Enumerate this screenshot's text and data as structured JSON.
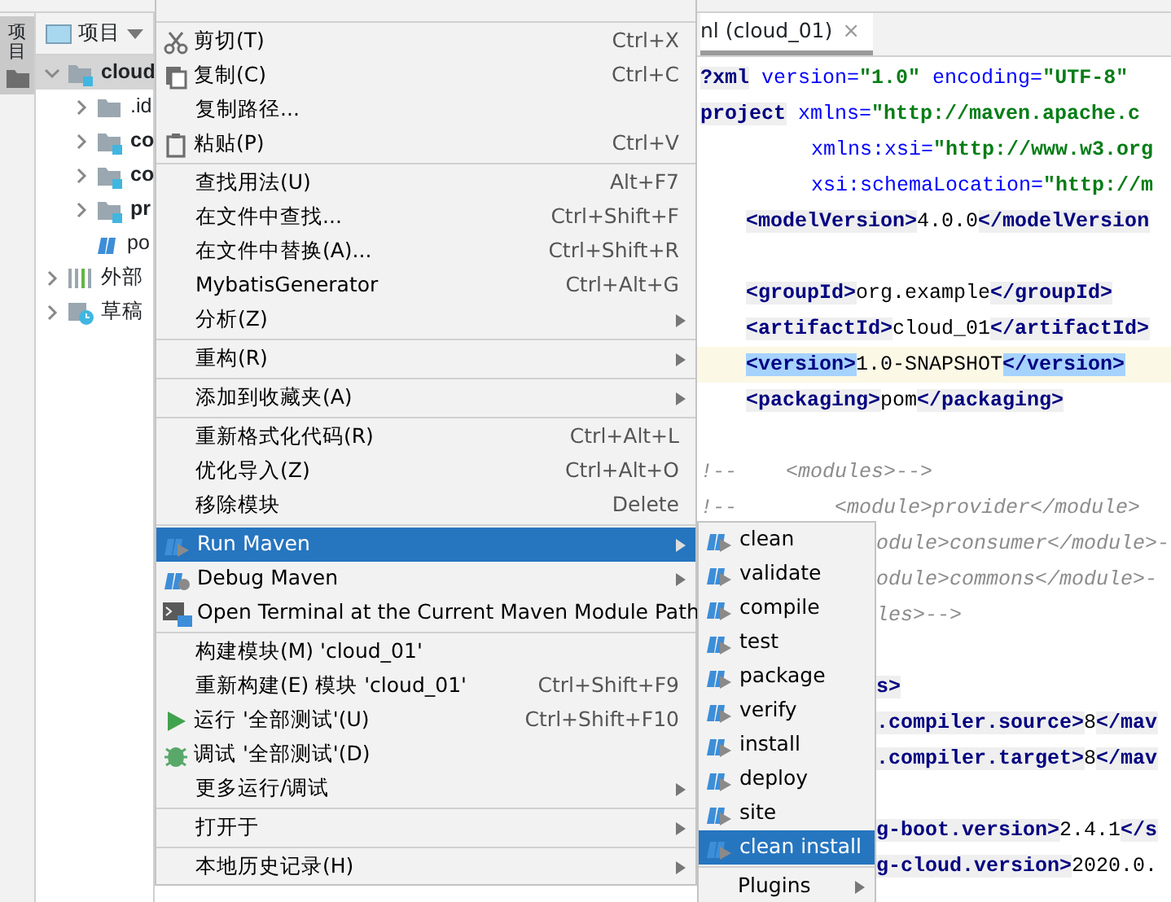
{
  "tool_window_tab": {
    "label": "项目",
    "selected": true
  },
  "project_panel": {
    "title": "项目",
    "tree": [
      {
        "label": "cloud",
        "kind": "module",
        "expanded": true,
        "selected": true,
        "children": [
          {
            "label": ".id",
            "kind": "folder",
            "expanded": false,
            "selected": false
          },
          {
            "label": "co",
            "kind": "module",
            "expanded": false,
            "selected": false
          },
          {
            "label": "co",
            "kind": "module",
            "expanded": false,
            "selected": false
          },
          {
            "label": "pr",
            "kind": "module",
            "expanded": false,
            "selected": false
          },
          {
            "label": "po",
            "kind": "maven",
            "selected": false
          }
        ]
      },
      {
        "label": "外部",
        "kind": "library",
        "expanded": false,
        "selected": false
      },
      {
        "label": "草稿",
        "kind": "scratch",
        "expanded": false,
        "selected": false
      }
    ]
  },
  "editor": {
    "tab": {
      "label": "nl (cloud_01)",
      "close": "×",
      "selected": true
    },
    "lines": [
      {
        "kind": "code",
        "current": false,
        "segments": [
          {
            "kind": "tag",
            "text": "?xml"
          },
          {
            "kind": "attr",
            "text": " version="
          },
          {
            "kind": "str",
            "text": "\"1.0\""
          },
          {
            "kind": "attr",
            "text": " encoding="
          },
          {
            "kind": "str",
            "text": "\"UTF-8\""
          }
        ]
      },
      {
        "kind": "code",
        "current": false,
        "segments": [
          {
            "kind": "tag",
            "text": "project"
          },
          {
            "kind": "attr",
            "text": " xmlns="
          },
          {
            "kind": "str",
            "text": "\"http://maven.apache.c"
          }
        ]
      },
      {
        "kind": "attr-indented",
        "current": false,
        "segments": [
          {
            "kind": "attr",
            "text": "xmlns:xsi="
          },
          {
            "kind": "str",
            "text": "\"http://www.w3.org"
          }
        ]
      },
      {
        "kind": "attr-indented",
        "current": false,
        "segments": [
          {
            "kind": "attr",
            "text": "xsi:schemaLocation="
          },
          {
            "kind": "str",
            "text": "\"http://m"
          }
        ]
      },
      {
        "kind": "indented",
        "current": false,
        "segments": [
          {
            "kind": "tag",
            "text": "<modelVersion>"
          },
          {
            "kind": "text",
            "text": "4.0.0"
          },
          {
            "kind": "tag",
            "text": "</modelVersion"
          }
        ]
      },
      {
        "kind": "blank"
      },
      {
        "kind": "indented",
        "current": false,
        "segments": [
          {
            "kind": "tag",
            "text": "<groupId>"
          },
          {
            "kind": "text",
            "text": "org.example"
          },
          {
            "kind": "tag",
            "text": "</groupId>"
          }
        ]
      },
      {
        "kind": "indented",
        "current": false,
        "segments": [
          {
            "kind": "tag",
            "text": "<artifactId>"
          },
          {
            "kind": "text",
            "text": "cloud_01"
          },
          {
            "kind": "tag",
            "text": "</artifactId>"
          }
        ]
      },
      {
        "kind": "indented",
        "current": true,
        "segments": [
          {
            "kind": "match",
            "text": "<version>"
          },
          {
            "kind": "text",
            "text": "1.0-SNAPSHOT"
          },
          {
            "kind": "match",
            "text": "</version>"
          }
        ]
      },
      {
        "kind": "indented",
        "current": false,
        "segments": [
          {
            "kind": "tag",
            "text": "<packaging>"
          },
          {
            "kind": "text",
            "text": "pom"
          },
          {
            "kind": "tag",
            "text": "</packaging>"
          }
        ]
      },
      {
        "kind": "blank"
      },
      {
        "kind": "code",
        "current": false,
        "segments": [
          {
            "kind": "comment",
            "text": "!--    <modules>-->"
          }
        ]
      },
      {
        "kind": "code",
        "current": false,
        "segments": [
          {
            "kind": "comment",
            "text": "!--        <module>provider</module>"
          }
        ]
      },
      {
        "kind": "clipped",
        "current": false,
        "segments": [
          {
            "kind": "comment",
            "text": "odule>consumer</module>-"
          }
        ]
      },
      {
        "kind": "clipped",
        "current": false,
        "segments": [
          {
            "kind": "comment",
            "text": "odule>commons</module>-"
          }
        ]
      },
      {
        "kind": "clipped",
        "current": false,
        "segments": [
          {
            "kind": "comment",
            "text": "les>-->"
          }
        ]
      },
      {
        "kind": "blank"
      },
      {
        "kind": "clipped",
        "current": false,
        "segments": [
          {
            "kind": "tag",
            "text": "s>"
          }
        ]
      },
      {
        "kind": "clipped",
        "current": false,
        "segments": [
          {
            "kind": "tag",
            "text": ".compiler.source>"
          },
          {
            "kind": "text",
            "text": "8"
          },
          {
            "kind": "tag",
            "text": "</mav"
          }
        ]
      },
      {
        "kind": "clipped",
        "current": false,
        "segments": [
          {
            "kind": "tag",
            "text": ".compiler.target>"
          },
          {
            "kind": "text",
            "text": "8"
          },
          {
            "kind": "tag",
            "text": "</mav"
          }
        ]
      },
      {
        "kind": "blank"
      },
      {
        "kind": "clipped",
        "current": false,
        "segments": [
          {
            "kind": "tag",
            "text": "g-boot.version>"
          },
          {
            "kind": "text",
            "text": "2.4.1"
          },
          {
            "kind": "tag",
            "text": "</s"
          }
        ]
      },
      {
        "kind": "clipped",
        "current": false,
        "segments": [
          {
            "kind": "tag",
            "text": "g-cloud.version>"
          },
          {
            "kind": "text",
            "text": "2020.0."
          }
        ]
      }
    ]
  },
  "context_menu": [
    {
      "kind": "hidden-row"
    },
    {
      "kind": "separator"
    },
    {
      "kind": "cut",
      "label": "剪切(T)",
      "shortcut": "Ctrl+X",
      "selected": false
    },
    {
      "kind": "copy",
      "label": "复制(C)",
      "shortcut": "Ctrl+C",
      "selected": false
    },
    {
      "kind": "plain",
      "label": "复制路径...",
      "selected": false
    },
    {
      "kind": "paste",
      "label": "粘贴(P)",
      "shortcut": "Ctrl+V",
      "selected": false
    },
    {
      "kind": "separator"
    },
    {
      "kind": "plain",
      "label": "查找用法(U)",
      "shortcut": "Alt+F7",
      "selected": false
    },
    {
      "kind": "plain",
      "label": "在文件中查找...",
      "shortcut": "Ctrl+Shift+F",
      "selected": false
    },
    {
      "kind": "plain",
      "label": "在文件中替换(A)...",
      "shortcut": "Ctrl+Shift+R",
      "selected": false
    },
    {
      "kind": "plain",
      "label": "MybatisGenerator",
      "shortcut": "Ctrl+Alt+G",
      "selected": false
    },
    {
      "kind": "plain",
      "label": "分析(Z)",
      "submenu": true,
      "selected": false
    },
    {
      "kind": "separator"
    },
    {
      "kind": "plain",
      "label": "重构(R)",
      "submenu": true,
      "selected": false
    },
    {
      "kind": "separator"
    },
    {
      "kind": "plain",
      "label": "添加到收藏夹(A)",
      "submenu": true,
      "selected": false
    },
    {
      "kind": "separator"
    },
    {
      "kind": "plain",
      "label": "重新格式化代码(R)",
      "shortcut": "Ctrl+Alt+L",
      "selected": false
    },
    {
      "kind": "plain",
      "label": "优化导入(Z)",
      "shortcut": "Ctrl+Alt+O",
      "selected": false
    },
    {
      "kind": "plain",
      "label": "移除模块",
      "shortcut": "Delete",
      "selected": false
    },
    {
      "kind": "separator"
    },
    {
      "kind": "maven-run",
      "label": "Run Maven",
      "submenu": true,
      "selected": true
    },
    {
      "kind": "maven-debug",
      "label": "Debug Maven",
      "submenu": true,
      "selected": false
    },
    {
      "kind": "terminal",
      "label": "Open Terminal at the Current Maven Module Path",
      "selected": false
    },
    {
      "kind": "separator"
    },
    {
      "kind": "plain",
      "label": "构建模块(M) 'cloud_01'",
      "selected": false
    },
    {
      "kind": "plain",
      "label": "重新构建(E) 模块 'cloud_01'",
      "shortcut": "Ctrl+Shift+F9",
      "selected": false
    },
    {
      "kind": "run",
      "label": "运行 '全部测试'(U)",
      "shortcut": "Ctrl+Shift+F10",
      "selected": false
    },
    {
      "kind": "debug",
      "label": "调试 '全部测试'(D)",
      "selected": false
    },
    {
      "kind": "plain",
      "label": "更多运行/调试",
      "submenu": true,
      "selected": false
    },
    {
      "kind": "separator"
    },
    {
      "kind": "plain",
      "label": "打开于",
      "submenu": true,
      "selected": false
    },
    {
      "kind": "separator"
    },
    {
      "kind": "plain",
      "label": "本地历史记录(H)",
      "submenu": true,
      "selected": false
    }
  ],
  "maven_submenu": [
    {
      "kind": "maven-run",
      "label": "clean",
      "selected": false
    },
    {
      "kind": "maven-run",
      "label": "validate",
      "selected": false
    },
    {
      "kind": "maven-run",
      "label": "compile",
      "selected": false
    },
    {
      "kind": "maven-run",
      "label": "test",
      "selected": false
    },
    {
      "kind": "maven-run",
      "label": "package",
      "selected": false
    },
    {
      "kind": "maven-run",
      "label": "verify",
      "selected": false
    },
    {
      "kind": "maven-run",
      "label": "install",
      "selected": false
    },
    {
      "kind": "maven-run",
      "label": "deploy",
      "selected": false
    },
    {
      "kind": "maven-run",
      "label": "site",
      "selected": false
    },
    {
      "kind": "maven-run",
      "label": "clean install",
      "selected": true
    },
    {
      "kind": "separator"
    },
    {
      "kind": "plain",
      "label": "Plugins",
      "submenu": true,
      "selected": false
    }
  ]
}
